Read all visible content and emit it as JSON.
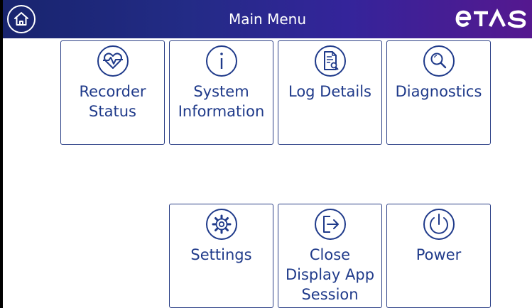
{
  "header": {
    "title": "Main Menu",
    "logo_text": "ETAS"
  },
  "tiles": [
    {
      "label": "Recorder\nStatus",
      "icon": "heart-pulse-icon"
    },
    {
      "label": "System\nInformation",
      "icon": "info-icon"
    },
    {
      "label": "Log Details",
      "icon": "document-search-icon"
    },
    {
      "label": "Diagnostics",
      "icon": "magnifier-icon"
    },
    {
      "label": "Settings",
      "icon": "gear-icon"
    },
    {
      "label": "Close\nDisplay App\nSession",
      "icon": "exit-icon"
    },
    {
      "label": "Power",
      "icon": "power-icon"
    }
  ],
  "colors": {
    "header_start": "#18246e",
    "header_end": "#55188f",
    "accent": "#1f3a8a"
  }
}
